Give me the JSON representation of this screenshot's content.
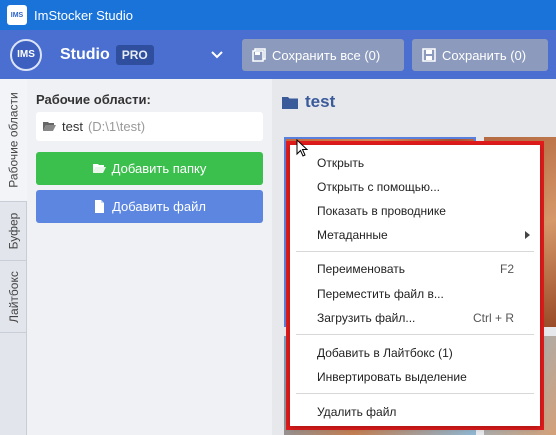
{
  "window": {
    "title": "ImStocker Studio",
    "logo_text": "IMS"
  },
  "header": {
    "badge_text": "IMS",
    "studio_label": "Studio",
    "pro_label": "PRO",
    "save_all_label": "Сохранить все (0)",
    "save_label": "Сохранить (0)"
  },
  "side_tabs": [
    "Рабочие области",
    "Буфер",
    "Лайтбокс"
  ],
  "workspace": {
    "title": "Рабочие области:",
    "item_name": "test",
    "item_path": "(D:\\1\\test)",
    "add_folder_label": "Добавить папку",
    "add_file_label": "Добавить файл"
  },
  "content": {
    "folder_title": "test"
  },
  "context_menu": {
    "open": "Открыть",
    "open_with": "Открыть с помощью...",
    "show_in_explorer": "Показать в проводнике",
    "metadata": "Метаданные",
    "rename": "Переименовать",
    "rename_shortcut": "F2",
    "move_file": "Переместить файл в...",
    "upload_file": "Загрузить файл...",
    "upload_shortcut": "Ctrl + R",
    "add_to_lightbox": "Добавить в Лайтбокс (1)",
    "invert_selection": "Инвертировать выделение",
    "delete_file": "Удалить файл"
  },
  "colors": {
    "titlebar": "#1a73d9",
    "header": "#4a6fd0",
    "add_folder": "#3bbf4d",
    "add_file": "#5c86e0",
    "highlight_frame": "#e21b1b"
  }
}
